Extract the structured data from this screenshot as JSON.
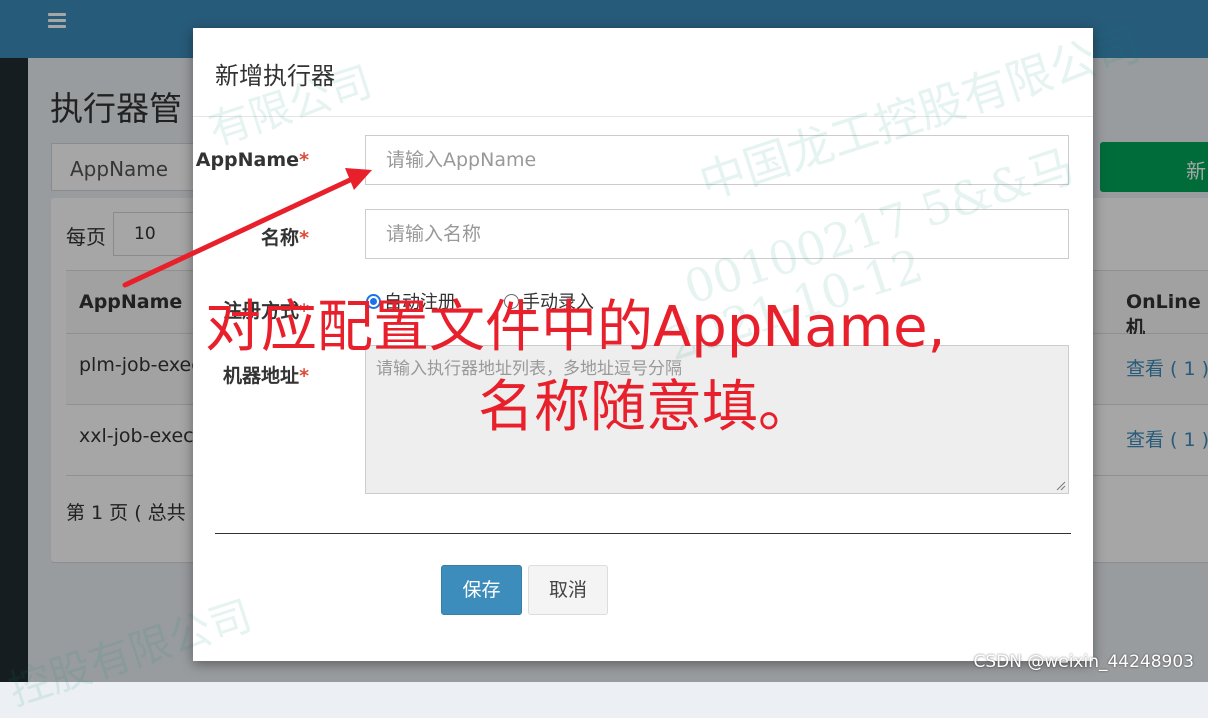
{
  "app": {
    "page_title": "执行器管",
    "filter_value": "AppName",
    "add_button": "新",
    "perpage_label": "每页",
    "perpage_value": "10",
    "table": {
      "headers": [
        "AppName",
        "OnLine 机"
      ],
      "rows": [
        {
          "appname": "plm-job-exec",
          "online": "查看 ( 1 )"
        },
        {
          "appname": "xxl-job-exec",
          "online": "查看 ( 1 )"
        }
      ]
    },
    "pager_text": "第 1 页 ( 总共"
  },
  "modal": {
    "title": "新增执行器",
    "fields": {
      "appname": {
        "label": "AppName",
        "required_mark": "*",
        "placeholder": "请输入AppName"
      },
      "name": {
        "label": "名称",
        "required_mark": "*",
        "placeholder": "请输入名称"
      },
      "register": {
        "label": "注册方式",
        "required_mark": "*",
        "options": [
          "自动注册",
          "手动录入"
        ],
        "selected": "自动注册"
      },
      "address": {
        "label": "机器地址",
        "required_mark": "*",
        "placeholder": "请输入执行器地址列表，多地址逗号分隔"
      }
    },
    "save_button": "保存",
    "cancel_button": "取消"
  },
  "annotation": {
    "line1": "对应配置文件中的AppName,",
    "line2": "名称随意填。",
    "color": "#e8202b"
  },
  "watermark": {
    "company": "中国龙工控股有限公司",
    "text2": "有限公司",
    "text3": "控股有限公司",
    "code": "00100217 5&&马",
    "date": "2021-10-12"
  },
  "footer": {
    "csdn": "CSDN @weixin_44248903"
  }
}
